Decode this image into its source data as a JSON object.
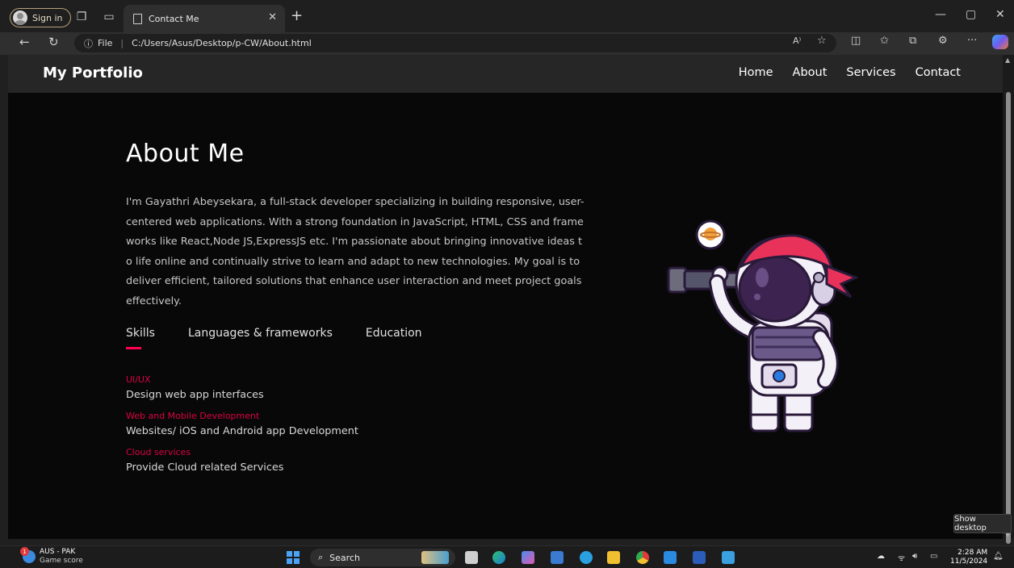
{
  "browser": {
    "signin_label": "Sign in",
    "tab_title": "Contact Me",
    "url_scheme": "File",
    "url_path": "C:/Users/Asus/Desktop/p-CW/About.html"
  },
  "site": {
    "logo": "My Portfolio",
    "nav": [
      "Home",
      "About",
      "Services",
      "Contact"
    ]
  },
  "about": {
    "title": "About Me",
    "text": "I'm Gayathri Abeysekara, a full-stack developer specializing in building responsive, user-centered web applications. With a strong foundation in JavaScript, HTML, CSS and frameworks like React,Node JS,ExpressJS etc. I'm passionate about bringing innovative ideas to life online and continually strive to learn and adapt to new technologies. My goal is to deliver efficient, tailored solutions that enhance user interaction and meet project goals effectively.",
    "tabs": [
      "Skills",
      "Languages & frameworks",
      "Education"
    ],
    "skills": [
      {
        "title": "UI/UX",
        "desc": "Design web app interfaces"
      },
      {
        "title": "Web and Mobile Development",
        "desc": "Websites/ iOS and Android app Development"
      },
      {
        "title": "Cloud services",
        "desc": "Provide Cloud related Services"
      }
    ]
  },
  "tooltip": "Show desktop",
  "taskbar": {
    "weather_line1": "AUS - PAK",
    "weather_line2": "Game score",
    "weather_badge": "1",
    "search": "Search",
    "time": "2:28 AM",
    "date": "11/5/2024"
  },
  "colors": {
    "accent": "#ff004f",
    "page_bg": "#080808",
    "header_bg": "#262626"
  },
  "icons": [
    "profile-icon",
    "workspaces-icon",
    "tab-actions-icon",
    "document-icon",
    "close-icon",
    "plus-icon",
    "minimize-icon",
    "maximize-icon",
    "back-icon",
    "refresh-icon",
    "info-icon",
    "read-aloud-icon",
    "favorite-icon",
    "split-screen-icon",
    "favorites-icon",
    "collections-icon",
    "extensions-icon",
    "more-icon",
    "copilot-icon",
    "windows-start-icon",
    "search-icon"
  ]
}
